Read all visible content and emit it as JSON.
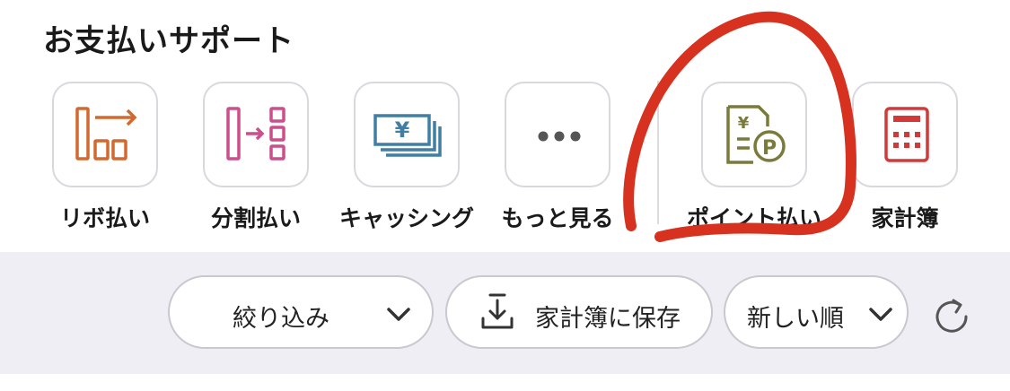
{
  "section": {
    "title": "お支払いサポート"
  },
  "shortcuts": [
    {
      "label": "リボ払い",
      "icon": "revolving-payment-icon",
      "color": "#d2692f"
    },
    {
      "label": "分割払い",
      "icon": "installment-payment-icon",
      "color": "#cc4f8c"
    },
    {
      "label": "キャッシング",
      "icon": "cash-advance-icon",
      "color": "#3e7fa3"
    },
    {
      "label": "もっと見る",
      "icon": "more-dots-icon",
      "color": "#555555"
    },
    {
      "label": "ポイント払い",
      "icon": "point-payment-icon",
      "color": "#7a7a3a"
    },
    {
      "label": "家計簿",
      "icon": "calculator-icon",
      "color": "#d23a3a"
    }
  ],
  "yen_glyph": "¥",
  "point_glyph": "P",
  "toolbar": {
    "filter_label": "絞り込み",
    "save_label": "家計簿に保存",
    "sort_label": "新しい順"
  },
  "colors": {
    "annotation": "#d6321f",
    "toolbar_bg": "#eeeef4",
    "tile_border": "#d8d8de"
  }
}
